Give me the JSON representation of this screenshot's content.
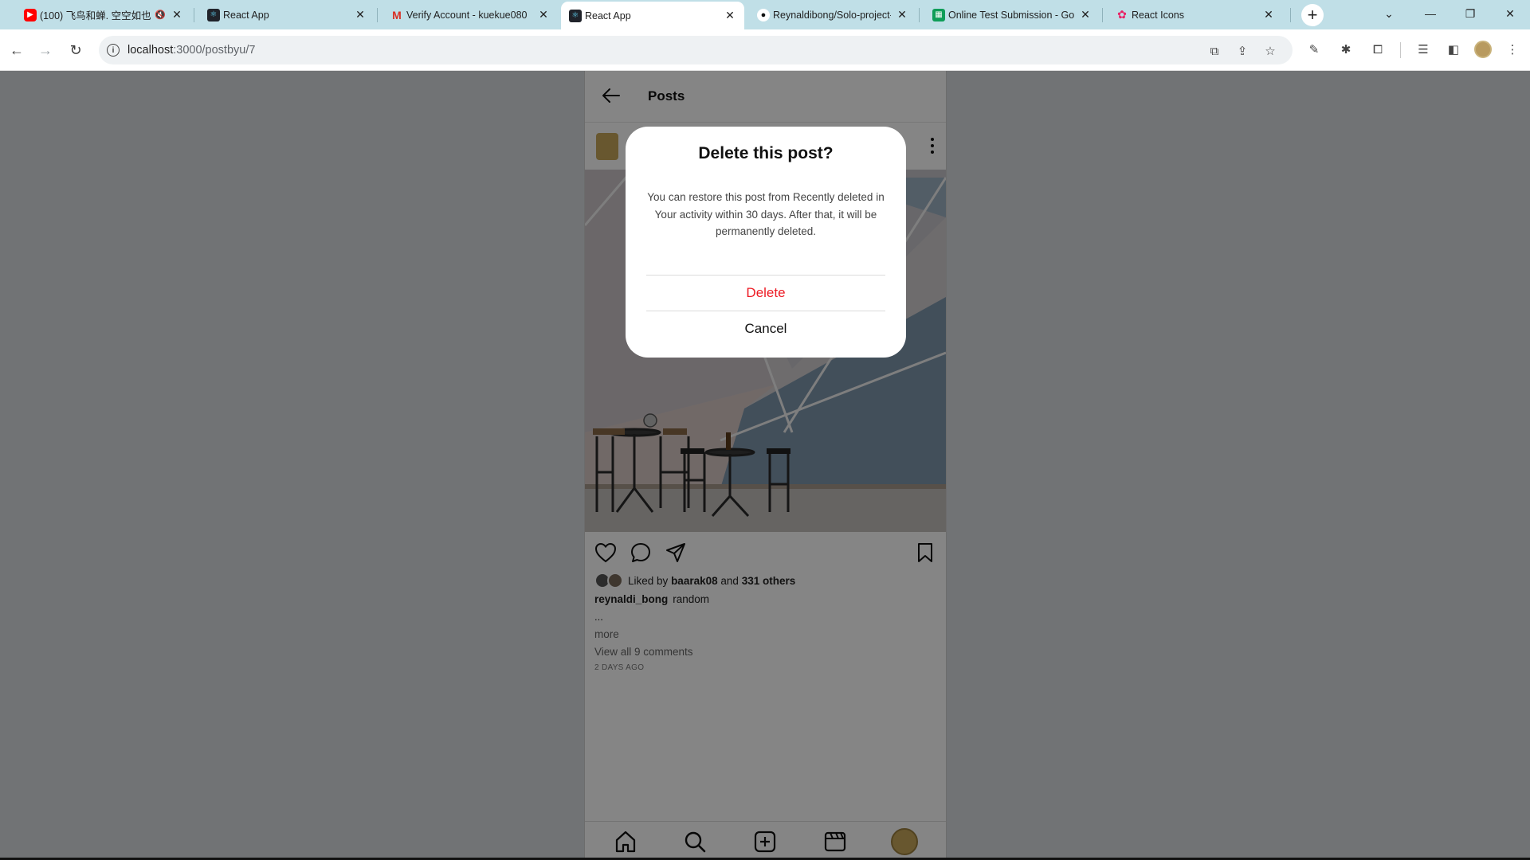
{
  "browser": {
    "tabs": [
      {
        "title": "(100) 飞鸟和蝉. 空空如也",
        "favicon": "youtube-icon",
        "muted": true
      },
      {
        "title": "React App",
        "favicon": "react-icon"
      },
      {
        "title": "Verify Account - kuekue080",
        "favicon": "gmail-icon"
      },
      {
        "title": "React App",
        "favicon": "react-icon",
        "active": true
      },
      {
        "title": "Reynaldibong/Solo-project-",
        "favicon": "github-icon"
      },
      {
        "title": "Online Test Submission - Go",
        "favicon": "sheets-icon"
      },
      {
        "title": "React Icons",
        "favicon": "react-icons-icon"
      }
    ],
    "address": {
      "host": "localhost",
      "path": ":3000/postbyu/7"
    }
  },
  "app": {
    "header_title": "Posts",
    "post": {
      "liked_by_prefix": "Liked by",
      "liked_by_user": "baarak08",
      "liked_and": "and",
      "liked_others": "331 others",
      "author": "reynaldi_bong",
      "caption": "random",
      "ellipsis": "...",
      "more": "more",
      "view_comments": "View all 9 comments",
      "time_ago": "2 DAYS AGO"
    }
  },
  "modal": {
    "title": "Delete this post?",
    "body": "You can restore this post from Recently deleted in Your activity within 30 days. After that, it will be permanently deleted.",
    "delete_label": "Delete",
    "cancel_label": "Cancel",
    "delete_color": "#ed1b24"
  }
}
